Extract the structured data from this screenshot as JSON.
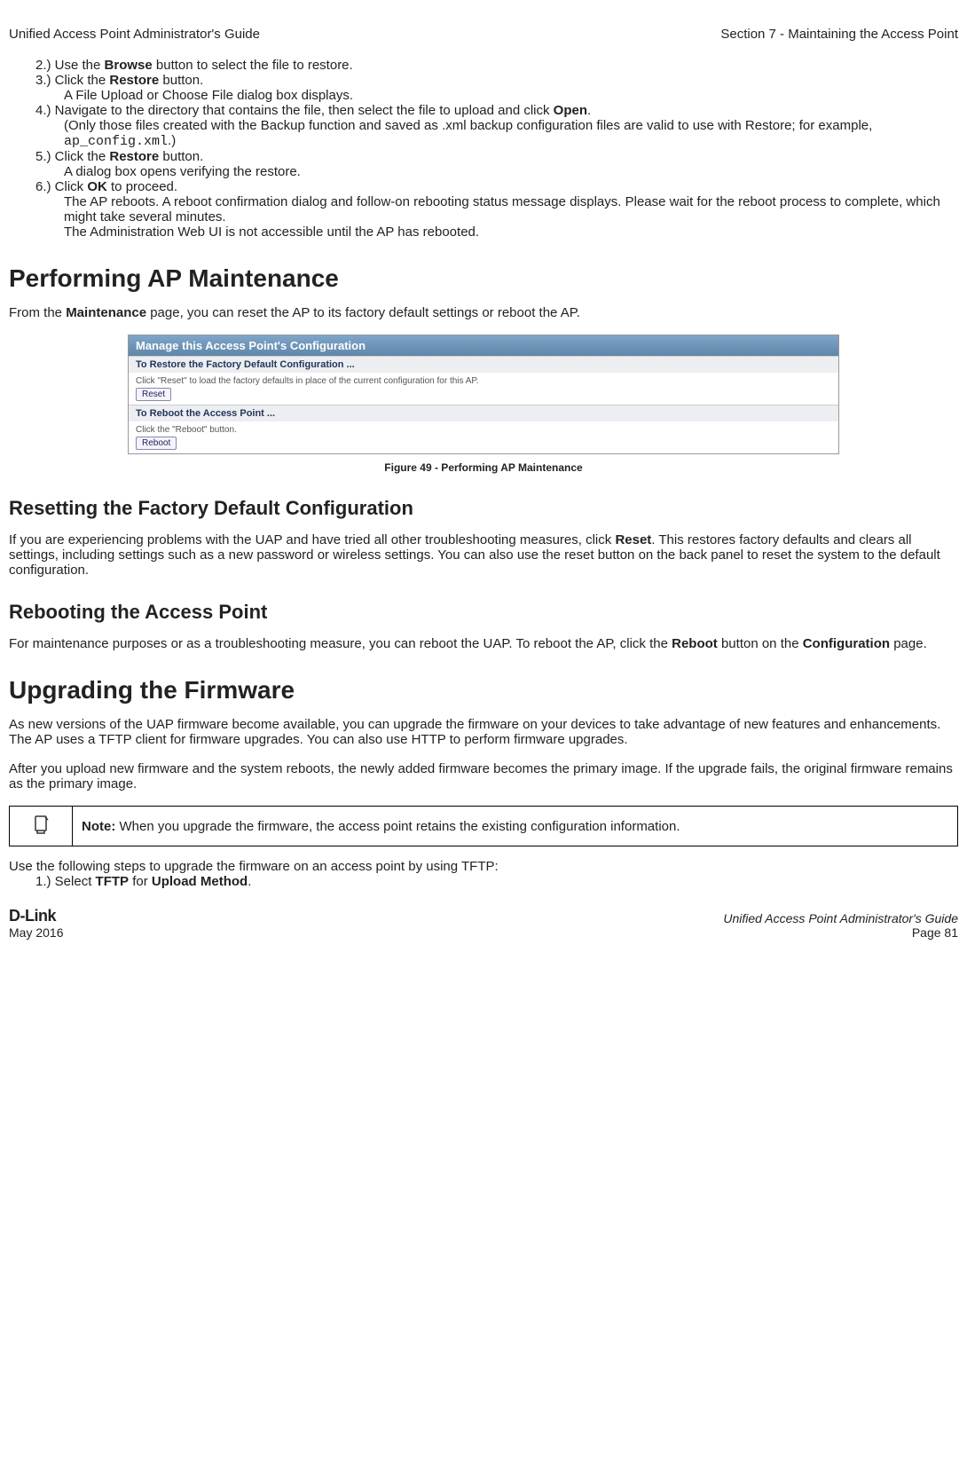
{
  "header": {
    "left": "Unified Access Point Administrator's Guide",
    "right": "Section 7 - Maintaining the Access Point"
  },
  "steps_top": {
    "s2_pre": "2.)  Use the ",
    "s2_bold": "Browse",
    "s2_post": " button to select the file to restore.",
    "s3_pre": "3.)  Click the ",
    "s3_bold": "Restore",
    "s3_post": " button.",
    "s3_cont": "A File Upload or Choose File dialog box displays.",
    "s4_pre": "4.)  Navigate to the directory that contains the file, then select the file to upload and click ",
    "s4_bold": "Open",
    "s4_post": ".",
    "s4_cont_pre": "(Only those files created with the Backup function and saved as .xml backup configuration files are valid to use with Restore; for example, ",
    "s4_cont_mono": "ap_config.xml",
    "s4_cont_post": ".)",
    "s5_pre": "5.)  Click the ",
    "s5_bold": "Restore",
    "s5_post": " button.",
    "s5_cont": "A dialog box opens verifying the restore.",
    "s6_pre": "6.)  Click ",
    "s6_bold": "OK",
    "s6_post": " to proceed.",
    "s6_cont1": "The AP reboots. A reboot confirmation dialog and follow-on rebooting status message displays. Please wait for the reboot process to complete, which might take several minutes.",
    "s6_cont2": "The Administration Web UI is not accessible until the AP has rebooted."
  },
  "h1_maint": "Performing AP Maintenance",
  "p_maint_pre": "From the ",
  "p_maint_bold": "Maintenance",
  "p_maint_post": " page, you can reset the AP to its factory default settings or reboot the AP.",
  "ap_panel": {
    "title": "Manage this Access Point's Configuration",
    "sec1_head": "To Restore the Factory Default Configuration ...",
    "sec1_text": "Click \"Reset\" to load the factory defaults in place of the current configuration for this AP.",
    "btn_reset": "Reset",
    "sec2_head": "To Reboot the Access Point ...",
    "sec2_text": "Click the \"Reboot\" button.",
    "btn_reboot": "Reboot"
  },
  "fig_caption": "Figure 49 - Performing AP Maintenance",
  "h2_reset": "Resetting the Factory Default Configuration",
  "p_reset_pre": "If you are experiencing problems with the UAP and have tried all other troubleshooting measures, click ",
  "p_reset_bold": "Reset",
  "p_reset_post": ". This restores factory defaults and clears all settings, including settings such as a new password or wireless settings. You can also use the reset button on the back panel to reset the system to the default configuration.",
  "h2_reboot": "Rebooting the Access Point",
  "p_reboot_pre": "For maintenance purposes or as a troubleshooting measure, you can reboot the UAP. To reboot the AP, click the ",
  "p_reboot_bold1": "Reboot",
  "p_reboot_mid": " button on the ",
  "p_reboot_bold2": "Configuration",
  "p_reboot_post": " page.",
  "h1_upgrade": "Upgrading the Firmware",
  "p_upgrade1": "As new versions of the UAP firmware become available, you can upgrade the firmware on your devices to take advantage of new features and enhancements. The AP uses a TFTP client for firmware upgrades. You can also use HTTP to perform firmware upgrades.",
  "p_upgrade2": "After you upload new firmware and the system reboots, the newly added firmware becomes the primary image. If the upgrade fails, the original firmware remains as the primary image.",
  "note_bold": "Note:",
  "note_text": " When you upgrade the firmware, the access point retains the existing configuration information.",
  "p_tftp_intro": "Use the following steps to upgrade the firmware on an access point by using TFTP:",
  "step_tftp_pre": "1.)  Select ",
  "step_tftp_b1": "TFTP",
  "step_tftp_mid": " for ",
  "step_tftp_b2": "Upload Method",
  "step_tftp_post": ".",
  "footer": {
    "logo": "D-Link",
    "date": "May 2016",
    "right1": "Unified Access Point Administrator's Guide",
    "right2": "Page 81"
  }
}
